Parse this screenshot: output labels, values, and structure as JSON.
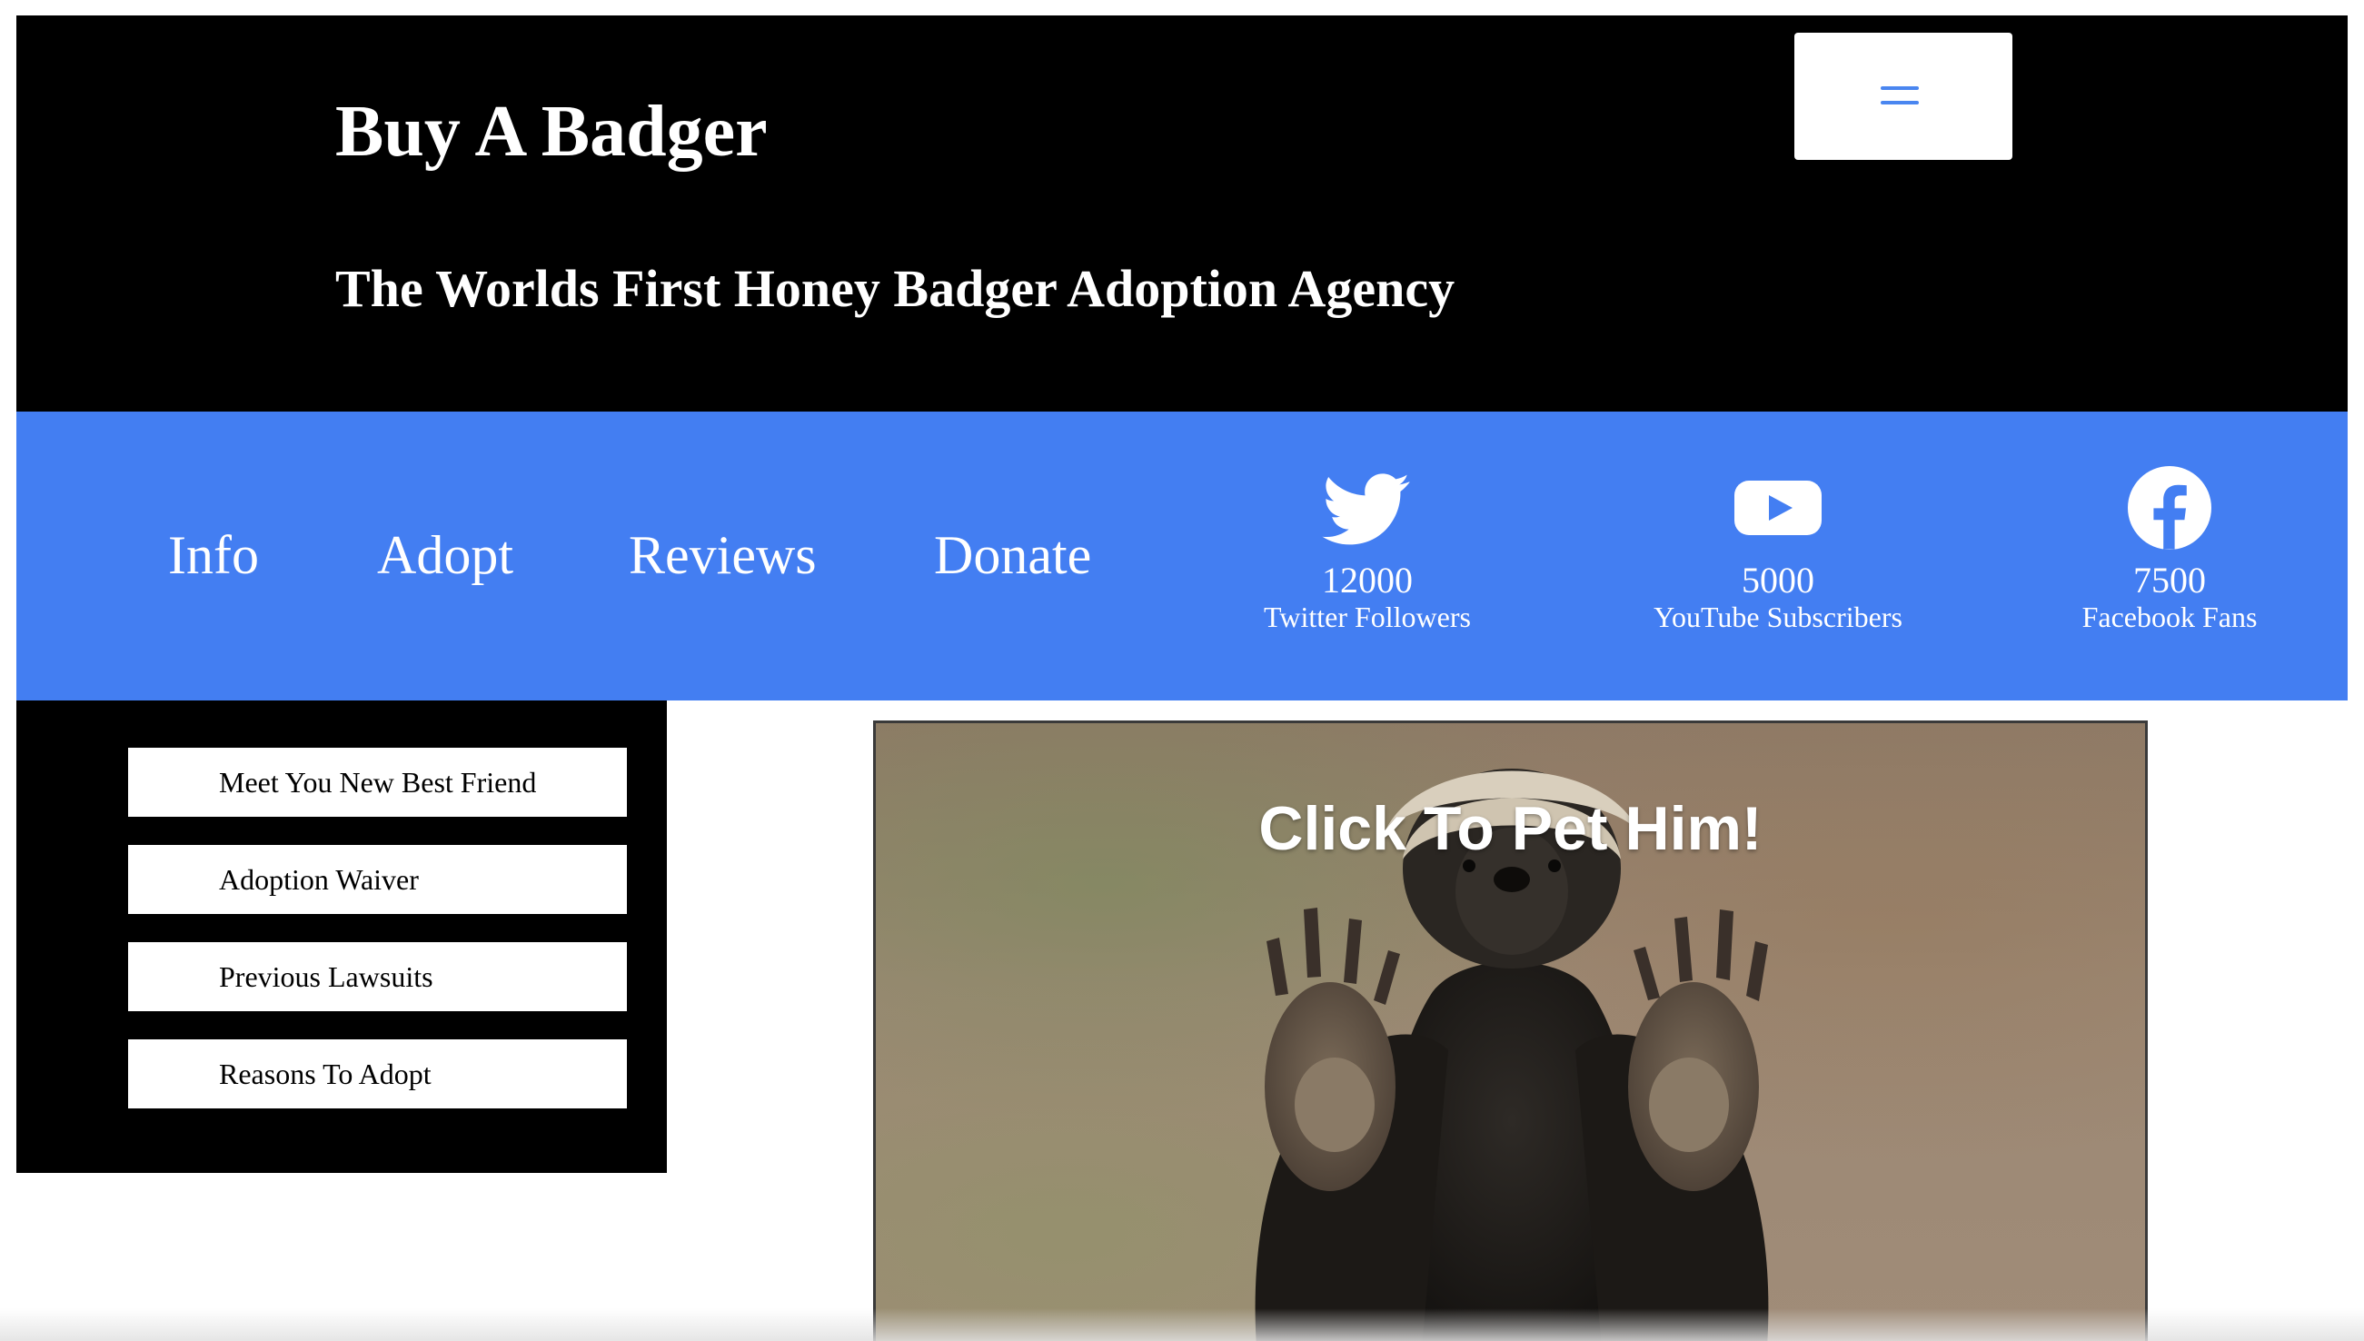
{
  "header": {
    "title": "Buy A Badger",
    "subtitle": "The Worlds First Honey Badger Adoption Agency",
    "menu_icon": "hamburger-menu-icon"
  },
  "nav": {
    "links": [
      {
        "label": "Info"
      },
      {
        "label": "Adopt"
      },
      {
        "label": "Reviews"
      },
      {
        "label": "Donate"
      }
    ],
    "social": [
      {
        "icon": "twitter-icon",
        "count": "12000",
        "label": "Twitter Followers"
      },
      {
        "icon": "youtube-icon",
        "count": "5000",
        "label": "YouTube Subscribers"
      },
      {
        "icon": "facebook-icon",
        "count": "7500",
        "label": "Facebook Fans"
      }
    ]
  },
  "sidebar": {
    "buttons": [
      {
        "label": "Meet You New Best Friend"
      },
      {
        "label": "Adoption Waiver"
      },
      {
        "label": "Previous Lawsuits"
      },
      {
        "label": "Reasons To Adopt"
      }
    ]
  },
  "hero": {
    "caption": "Click To Pet Him!",
    "image": "honey-badger-photo"
  },
  "colors": {
    "header_bg": "#000000",
    "nav_bg": "#437ef2",
    "sidebar_bg": "#000000",
    "accent": "#4a86f0",
    "text_light": "#ffffff"
  }
}
